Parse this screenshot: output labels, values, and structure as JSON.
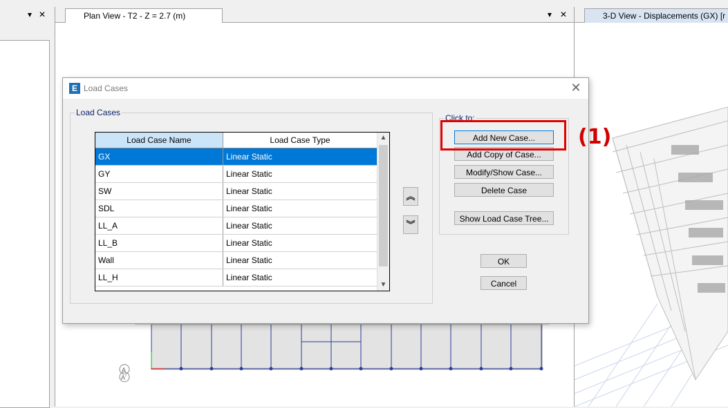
{
  "left_pane": {
    "pin": "▾",
    "close": "✕"
  },
  "plan_view": {
    "tab_title": "Plan View - T2 - Z = 2.7 (m)",
    "pin": "▾",
    "close": "✕",
    "grid_labels": [
      "A",
      "A'"
    ]
  },
  "view_3d": {
    "tab_title": "3-D View  - Displacements (GX)  [r"
  },
  "dialog": {
    "icon_letter": "E",
    "title": "Load Cases",
    "close": "✕",
    "group_label": "Load Cases",
    "columns": [
      "Load Case Name",
      "Load Case Type"
    ],
    "rows": [
      {
        "name": "GX",
        "type": "Linear Static",
        "selected": true
      },
      {
        "name": "GY",
        "type": "Linear Static"
      },
      {
        "name": "SW",
        "type": "Linear Static"
      },
      {
        "name": "SDL",
        "type": "Linear Static"
      },
      {
        "name": "LL_A",
        "type": "Linear Static"
      },
      {
        "name": "LL_B",
        "type": "Linear Static"
      },
      {
        "name": "Wall",
        "type": "Linear Static"
      },
      {
        "name": "LL_H",
        "type": "Linear Static"
      }
    ],
    "move_up": "⌃",
    "move_down": "⌄",
    "click_to_label": "Click to:",
    "buttons": {
      "add_new": "Add New Case...",
      "add_copy": "Add Copy of Case...",
      "modify_show": "Modify/Show Case...",
      "delete": "Delete Case",
      "show_tree": "Show Load Case Tree...",
      "ok": "OK",
      "cancel": "Cancel"
    }
  },
  "annotation": {
    "label": "(1)",
    "color": "#e00000"
  }
}
